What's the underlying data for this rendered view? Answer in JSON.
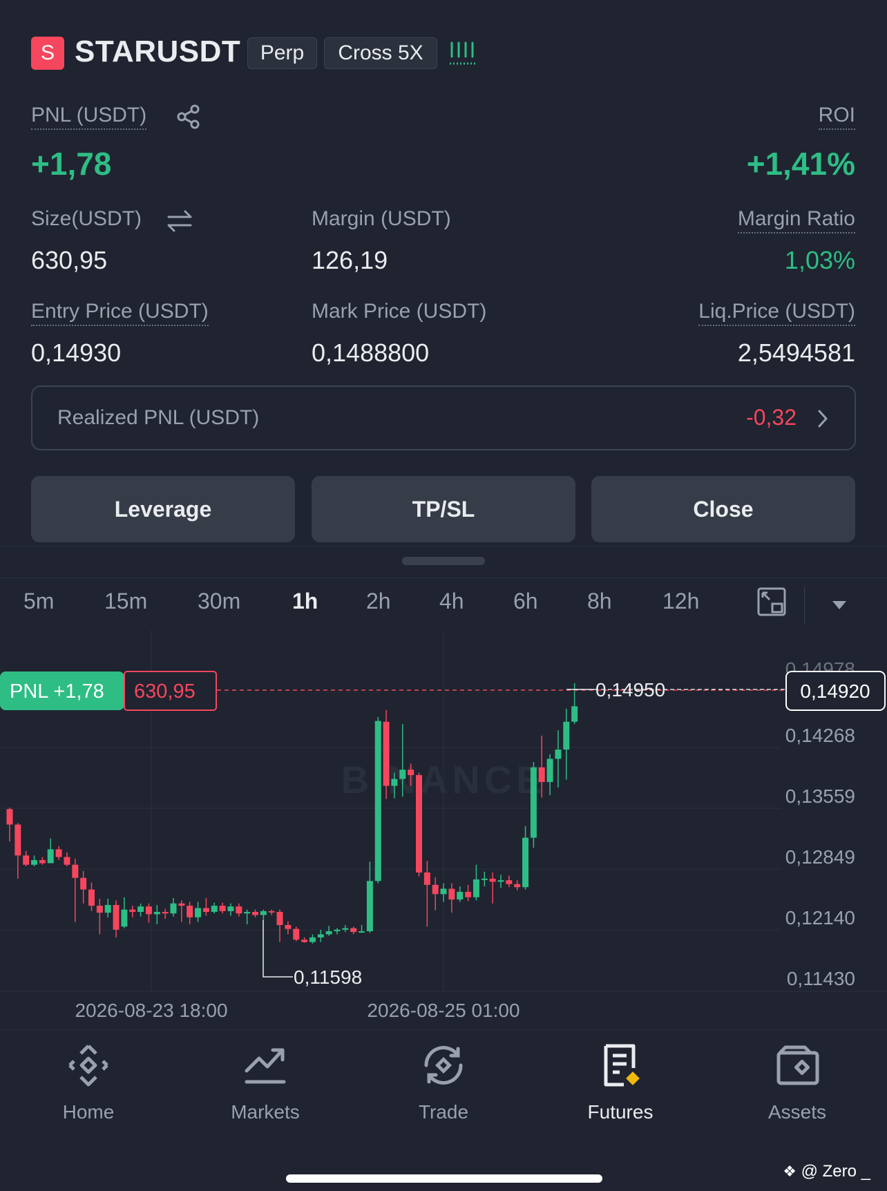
{
  "header": {
    "symbol_initial": "S",
    "symbol": "STARUSDT",
    "tag_type": "Perp",
    "tag_margin": "Cross 5X"
  },
  "position": {
    "pnl_label": "PNL (USDT)",
    "pnl_value": "+1,78",
    "roi_label": "ROI",
    "roi_value": "+1,41%",
    "size_label": "Size(USDT)",
    "size_value": "630,95",
    "margin_label": "Margin (USDT)",
    "margin_value": "126,19",
    "margin_ratio_label": "Margin Ratio",
    "margin_ratio_value": "1,03%",
    "entry_label": "Entry Price (USDT)",
    "entry_value": "0,14930",
    "mark_label": "Mark Price (USDT)",
    "mark_value": "0,1488800",
    "liq_label": "Liq.Price (USDT)",
    "liq_value": "2,5494581",
    "realized_label": "Realized PNL (USDT)",
    "realized_value": "-0,32"
  },
  "actions": {
    "leverage": "Leverage",
    "tpsl": "TP/SL",
    "close": "Close"
  },
  "timeframes": [
    "5m",
    "15m",
    "30m",
    "1h",
    "2h",
    "4h",
    "6h",
    "8h",
    "12h"
  ],
  "active_timeframe": "1h",
  "chart": {
    "pnl_tag": "PNL +1,78",
    "size_tag": "630,95",
    "current_price": "0,14920",
    "high_label": "0,14950",
    "low_label": "0,11598",
    "y_ticks": [
      "0,14268",
      "0,13559",
      "0,12849",
      "0,12140",
      "0,11430"
    ],
    "top_tick_partial": "0,14978",
    "x_ticks": [
      "2026-08-23 18:00",
      "2026-08-25 01:00"
    ],
    "watermark": "BINANCE"
  },
  "chart_data": {
    "type": "candlestick",
    "ylim": [
      0.1115,
      0.151
    ],
    "candles": [
      {
        "o": 0.1332,
        "c": 0.1312,
        "h": 0.1334,
        "l": 0.129
      },
      {
        "o": 0.1312,
        "c": 0.1272,
        "h": 0.1314,
        "l": 0.1242
      },
      {
        "o": 0.1272,
        "c": 0.126,
        "h": 0.1278,
        "l": 0.1258
      },
      {
        "o": 0.126,
        "c": 0.1266,
        "h": 0.1272,
        "l": 0.1258
      },
      {
        "o": 0.1266,
        "c": 0.1262,
        "h": 0.127,
        "l": 0.126
      },
      {
        "o": 0.1262,
        "c": 0.128,
        "h": 0.1294,
        "l": 0.1262
      },
      {
        "o": 0.128,
        "c": 0.127,
        "h": 0.1284,
        "l": 0.1266
      },
      {
        "o": 0.127,
        "c": 0.126,
        "h": 0.1276,
        "l": 0.1258
      },
      {
        "o": 0.126,
        "c": 0.1243,
        "h": 0.1268,
        "l": 0.1186
      },
      {
        "o": 0.1243,
        "c": 0.1228,
        "h": 0.1252,
        "l": 0.121
      },
      {
        "o": 0.1228,
        "c": 0.1207,
        "h": 0.1237,
        "l": 0.12
      },
      {
        "o": 0.1207,
        "c": 0.1198,
        "h": 0.1216,
        "l": 0.117
      },
      {
        "o": 0.1198,
        "c": 0.1208,
        "h": 0.1216,
        "l": 0.1192
      },
      {
        "o": 0.1208,
        "c": 0.1176,
        "h": 0.1214,
        "l": 0.1166
      },
      {
        "o": 0.118,
        "c": 0.1202,
        "h": 0.1218,
        "l": 0.1178
      },
      {
        "o": 0.1202,
        "c": 0.1199,
        "h": 0.1207,
        "l": 0.1192
      },
      {
        "o": 0.1199,
        "c": 0.1206,
        "h": 0.121,
        "l": 0.1193
      },
      {
        "o": 0.1206,
        "c": 0.1196,
        "h": 0.121,
        "l": 0.1185
      },
      {
        "o": 0.1196,
        "c": 0.1199,
        "h": 0.1208,
        "l": 0.1183
      },
      {
        "o": 0.1199,
        "c": 0.1197,
        "h": 0.1203,
        "l": 0.119
      },
      {
        "o": 0.1197,
        "c": 0.121,
        "h": 0.1217,
        "l": 0.1193
      },
      {
        "o": 0.121,
        "c": 0.1207,
        "h": 0.1214,
        "l": 0.1186
      },
      {
        "o": 0.1207,
        "c": 0.1192,
        "h": 0.1212,
        "l": 0.1183
      },
      {
        "o": 0.1192,
        "c": 0.1204,
        "h": 0.1212,
        "l": 0.1186
      },
      {
        "o": 0.1204,
        "c": 0.1199,
        "h": 0.1217,
        "l": 0.1194
      },
      {
        "o": 0.1199,
        "c": 0.1207,
        "h": 0.1211,
        "l": 0.1197
      },
      {
        "o": 0.1207,
        "c": 0.12,
        "h": 0.1211,
        "l": 0.1197
      },
      {
        "o": 0.12,
        "c": 0.1206,
        "h": 0.121,
        "l": 0.1194
      },
      {
        "o": 0.1206,
        "c": 0.1197,
        "h": 0.121,
        "l": 0.1193
      },
      {
        "o": 0.1197,
        "c": 0.1199,
        "h": 0.1202,
        "l": 0.1183
      },
      {
        "o": 0.1199,
        "c": 0.1195,
        "h": 0.1202,
        "l": 0.1192
      },
      {
        "o": 0.1195,
        "c": 0.12,
        "h": 0.1202,
        "l": 0.1187
      },
      {
        "o": 0.12,
        "c": 0.1199,
        "h": 0.1202,
        "l": 0.1195
      },
      {
        "o": 0.1199,
        "c": 0.1182,
        "h": 0.1202,
        "l": 0.116
      },
      {
        "o": 0.1182,
        "c": 0.1177,
        "h": 0.1187,
        "l": 0.117
      },
      {
        "o": 0.1177,
        "c": 0.1163,
        "h": 0.118,
        "l": 0.1161
      },
      {
        "o": 0.1163,
        "c": 0.116,
        "h": 0.1166,
        "l": 0.1159
      },
      {
        "o": 0.116,
        "c": 0.1166,
        "h": 0.117,
        "l": 0.1158
      },
      {
        "o": 0.1166,
        "c": 0.117,
        "h": 0.1176,
        "l": 0.116
      },
      {
        "o": 0.117,
        "c": 0.1174,
        "h": 0.1181,
        "l": 0.1168
      },
      {
        "o": 0.1174,
        "c": 0.1176,
        "h": 0.1178,
        "l": 0.117
      },
      {
        "o": 0.1176,
        "c": 0.1178,
        "h": 0.1182,
        "l": 0.1173
      },
      {
        "o": 0.1178,
        "c": 0.1173,
        "h": 0.118,
        "l": 0.117
      },
      {
        "o": 0.1173,
        "c": 0.1174,
        "h": 0.1182,
        "l": 0.1172
      },
      {
        "o": 0.1174,
        "c": 0.1239,
        "h": 0.1264,
        "l": 0.1172
      },
      {
        "o": 0.1239,
        "c": 0.1446,
        "h": 0.1451,
        "l": 0.1236
      },
      {
        "o": 0.1445,
        "c": 0.1362,
        "h": 0.146,
        "l": 0.1345
      },
      {
        "o": 0.1362,
        "c": 0.1371,
        "h": 0.1379,
        "l": 0.1346
      },
      {
        "o": 0.1371,
        "c": 0.1383,
        "h": 0.1442,
        "l": 0.1348
      },
      {
        "o": 0.1383,
        "c": 0.1376,
        "h": 0.1391,
        "l": 0.1362
      },
      {
        "o": 0.1376,
        "c": 0.125,
        "h": 0.1379,
        "l": 0.1245
      },
      {
        "o": 0.125,
        "c": 0.1234,
        "h": 0.1265,
        "l": 0.118
      },
      {
        "o": 0.1234,
        "c": 0.1222,
        "h": 0.1244,
        "l": 0.1201
      },
      {
        "o": 0.1222,
        "c": 0.1229,
        "h": 0.1236,
        "l": 0.1212
      },
      {
        "o": 0.1229,
        "c": 0.1215,
        "h": 0.1236,
        "l": 0.1198
      },
      {
        "o": 0.1215,
        "c": 0.1225,
        "h": 0.1232,
        "l": 0.1212
      },
      {
        "o": 0.1225,
        "c": 0.1218,
        "h": 0.1234,
        "l": 0.1213
      },
      {
        "o": 0.1218,
        "c": 0.1241,
        "h": 0.126,
        "l": 0.1214
      },
      {
        "o": 0.1241,
        "c": 0.1242,
        "h": 0.1251,
        "l": 0.1232
      },
      {
        "o": 0.1242,
        "c": 0.1238,
        "h": 0.125,
        "l": 0.121
      },
      {
        "o": 0.1238,
        "c": 0.124,
        "h": 0.1247,
        "l": 0.123
      },
      {
        "o": 0.124,
        "c": 0.1235,
        "h": 0.1246,
        "l": 0.1231
      },
      {
        "o": 0.1235,
        "c": 0.1231,
        "h": 0.124,
        "l": 0.1227
      },
      {
        "o": 0.1231,
        "c": 0.1295,
        "h": 0.131,
        "l": 0.1228
      },
      {
        "o": 0.1295,
        "c": 0.1386,
        "h": 0.1393,
        "l": 0.1282
      },
      {
        "o": 0.1386,
        "c": 0.1367,
        "h": 0.1427,
        "l": 0.1347
      },
      {
        "o": 0.1367,
        "c": 0.1397,
        "h": 0.1403,
        "l": 0.135
      },
      {
        "o": 0.1397,
        "c": 0.1409,
        "h": 0.1434,
        "l": 0.136
      },
      {
        "o": 0.1409,
        "c": 0.1445,
        "h": 0.1462,
        "l": 0.137
      },
      {
        "o": 0.1445,
        "c": 0.1465,
        "h": 0.1495,
        "l": 0.1442
      }
    ]
  },
  "nav": {
    "home": "Home",
    "markets": "Markets",
    "trade": "Trade",
    "futures": "Futures",
    "assets": "Assets"
  },
  "footer": {
    "watermark": "@ Zero _"
  }
}
